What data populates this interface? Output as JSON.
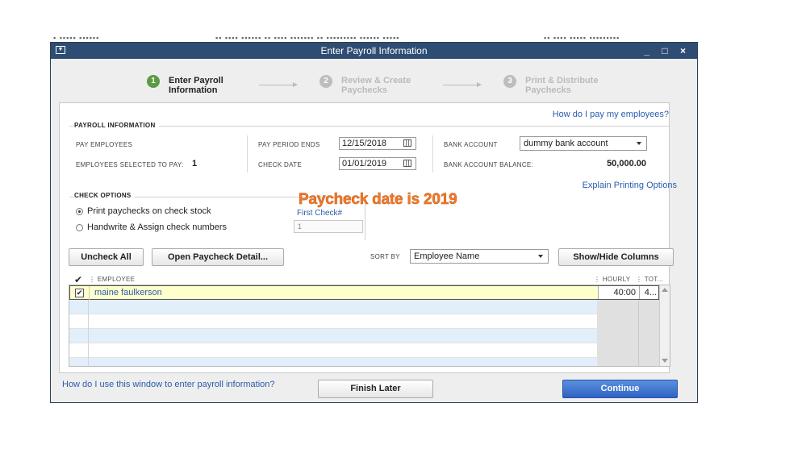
{
  "window": {
    "title": "Enter Payroll Information",
    "controls": "_ □ ×"
  },
  "steps": [
    {
      "num": "1",
      "line1": "Enter Payroll",
      "line2": "Information",
      "active": true
    },
    {
      "num": "2",
      "line1": "Review & Create",
      "line2": "Paychecks",
      "active": false
    },
    {
      "num": "3",
      "line1": "Print & Distribute",
      "line2": "Paychecks",
      "active": false
    }
  ],
  "help_link_top": "How do I pay my employees?",
  "payroll_info": {
    "heading": "PAYROLL INFORMATION",
    "pay_employees_label": "PAY EMPLOYEES",
    "employees_selected_label": "EMPLOYEES SELECTED TO PAY:",
    "employees_selected_value": "1",
    "pay_period_ends_label": "PAY PERIOD ENDS",
    "pay_period_ends_value": "12/15/2018",
    "check_date_label": "CHECK DATE",
    "check_date_value": "01/01/2019",
    "bank_account_label": "BANK ACCOUNT",
    "bank_account_value": "dummy bank account",
    "bank_balance_label": "BANK ACCOUNT BALANCE:",
    "bank_balance_value": "50,000.00"
  },
  "explain_printing_link": "Explain Printing Options",
  "check_options": {
    "heading": "CHECK OPTIONS",
    "option_print": "Print paychecks on check stock",
    "option_handwrite": "Handwrite & Assign check numbers",
    "first_check_label": "First Check#",
    "first_check_value": "1",
    "selected": "print"
  },
  "annotation": "Paycheck date is 2019",
  "toolbar": {
    "uncheck_all": "Uncheck All",
    "open_detail": "Open Paycheck Detail...",
    "sort_by_label": "SORT BY",
    "sort_by_value": "Employee Name",
    "show_hide": "Show/Hide Columns"
  },
  "table": {
    "check_header": "✔",
    "col_employee": "EMPLOYEE",
    "col_hourly": "HOURLY",
    "col_total": "TOT...",
    "rows": [
      {
        "checked": "✔",
        "employee": "maine faulkerson",
        "hourly": "40:00",
        "total": "4..."
      }
    ]
  },
  "footer": {
    "help_link": "How do I use this window to enter payroll information?",
    "finish_later": "Finish Later",
    "continue": "Continue"
  },
  "colors": {
    "titlebar": "#2f4d73",
    "link": "#2a5db0",
    "annotation": "#f07b2f",
    "step_active": "#5c9a45",
    "step_inactive": "#bdbdbd",
    "primary_button": "#2e63c4",
    "selected_row": "#ffffcc"
  }
}
